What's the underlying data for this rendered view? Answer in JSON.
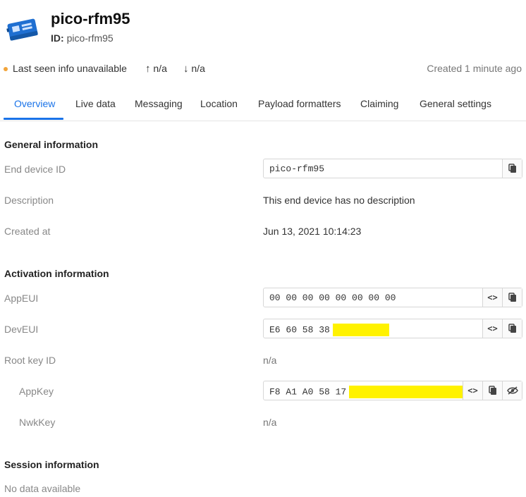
{
  "device": {
    "title": "pico-rfm95",
    "id_label": "ID:",
    "id_value": "pico-rfm95",
    "icon": "device-board-icon"
  },
  "status": {
    "last_seen": "Last seen info unavailable",
    "uplink": "n/a",
    "downlink": "n/a",
    "created": "Created 1 minute ago"
  },
  "tabs": [
    {
      "label": "Overview",
      "active": true
    },
    {
      "label": "Live data"
    },
    {
      "label": "Messaging"
    },
    {
      "label": "Location"
    },
    {
      "label": "Payload formatters"
    },
    {
      "label": "Claiming"
    },
    {
      "label": "General settings"
    }
  ],
  "general": {
    "title": "General information",
    "end_device_id_label": "End device ID",
    "end_device_id": "pico-rfm95",
    "description_label": "Description",
    "description": "This end device has no description",
    "created_at_label": "Created at",
    "created_at": "Jun 13, 2021 10:14:23"
  },
  "activation": {
    "title": "Activation information",
    "appeui_label": "AppEUI",
    "appeui": "00 00 00 00 00 00 00 00",
    "deveui_label": "DevEUI",
    "deveui": "E6 60 58 38",
    "root_key_label": "Root key ID",
    "root_key": "n/a",
    "appkey_label": "AppKey",
    "appkey": "F8 A1 A0 58 17",
    "nwkkey_label": "NwkKey",
    "nwkkey": "n/a"
  },
  "session": {
    "title": "Session information",
    "empty": "No data available"
  },
  "colors": {
    "accent": "#1a73e8",
    "status_dot": "#f2a43a",
    "redaction": "#fff200"
  }
}
